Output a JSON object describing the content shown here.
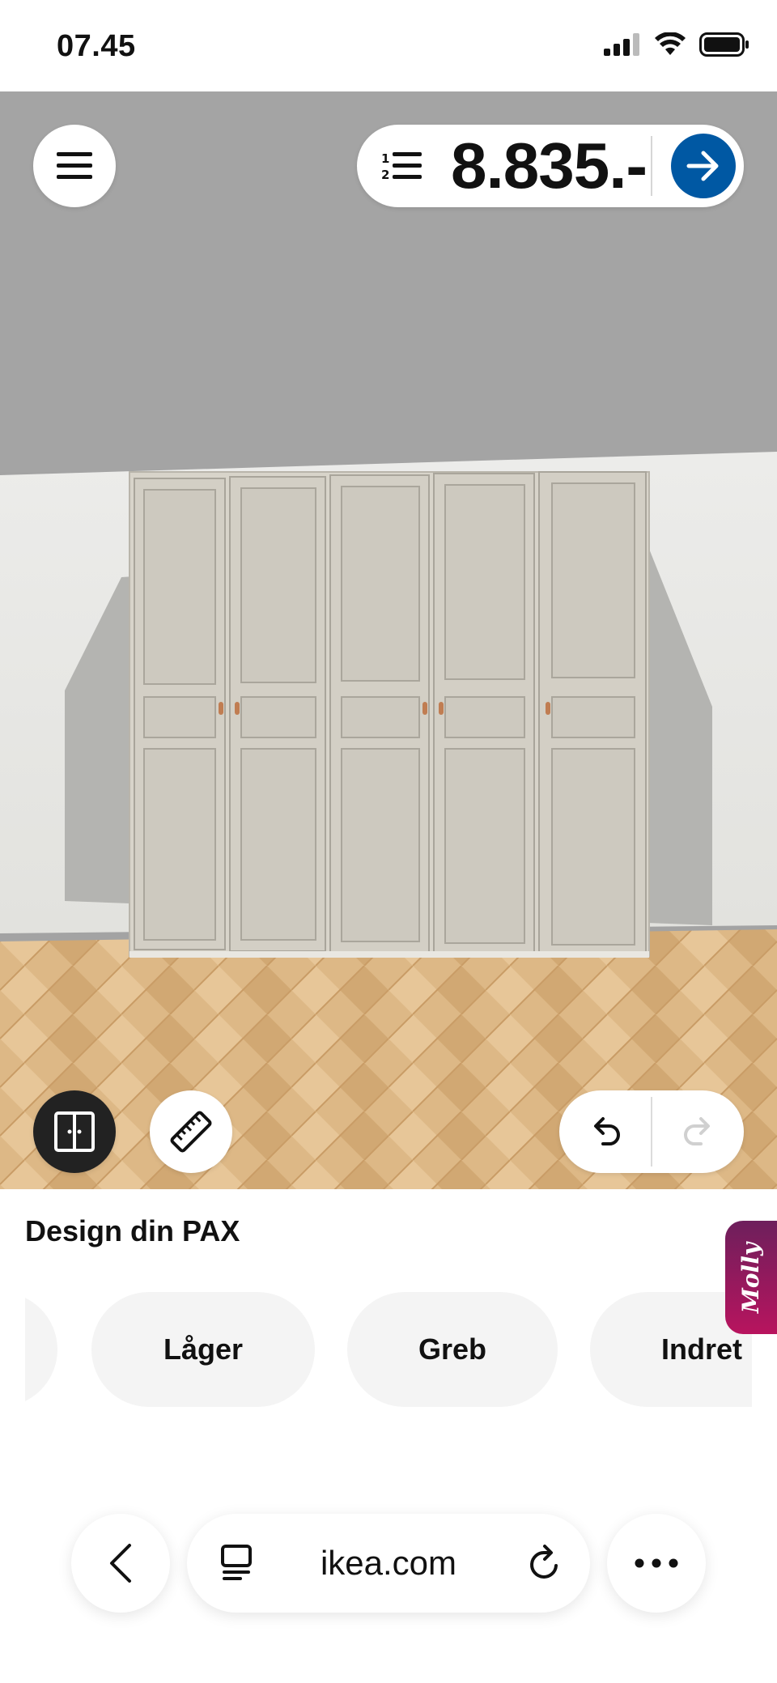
{
  "status_bar": {
    "time": "07.45"
  },
  "planner": {
    "total_price": "8.835.-",
    "icons": {
      "menu": "hamburger-menu-icon",
      "list": "numbered-list-icon",
      "checkout": "arrow-right-icon",
      "doors": "wardrobe-doors-icon",
      "measure": "ruler-icon",
      "undo": "undo-icon",
      "redo": "redo-icon"
    },
    "colors": {
      "accent_blue": "#0058a3",
      "wardrobe": "#d7d3c9",
      "wall": "#e6e6e2",
      "ceiling": "#a3a3a3",
      "floor": "#d9b07a"
    }
  },
  "sheet": {
    "title": "Design din PAX",
    "chips": [
      {
        "label": ""
      },
      {
        "label": "Låger"
      },
      {
        "label": "Greb"
      },
      {
        "label": "Indret"
      }
    ],
    "assistant_label": "Molly"
  },
  "browser": {
    "url": "ikea.com"
  }
}
